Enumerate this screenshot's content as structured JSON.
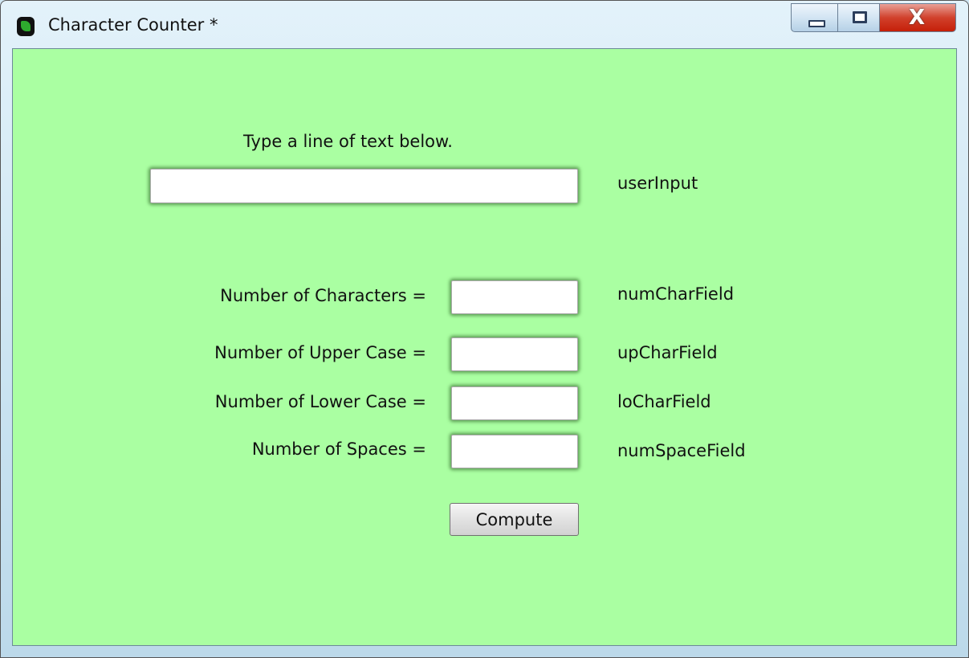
{
  "window": {
    "title": "Character Counter *",
    "app_icon": "leaf-icon",
    "controls": {
      "minimize": "minimize-icon",
      "maximize": "maximize-icon",
      "close": "close-icon",
      "close_glyph": "X"
    }
  },
  "form": {
    "prompt": "Type a line of text below.",
    "user_input": {
      "value": "",
      "id_label": "userInput"
    },
    "rows": [
      {
        "label": "Number of Characters =",
        "value": "",
        "id_label": "numCharField"
      },
      {
        "label": "Number of Upper Case =",
        "value": "",
        "id_label": "upCharField"
      },
      {
        "label": "Number of Lower Case =",
        "value": "",
        "id_label": "loCharField"
      },
      {
        "label": "Number of Spaces =",
        "value": "",
        "id_label": "numSpaceField"
      }
    ],
    "compute_label": "Compute"
  },
  "colors": {
    "background": "#aaffa2"
  }
}
